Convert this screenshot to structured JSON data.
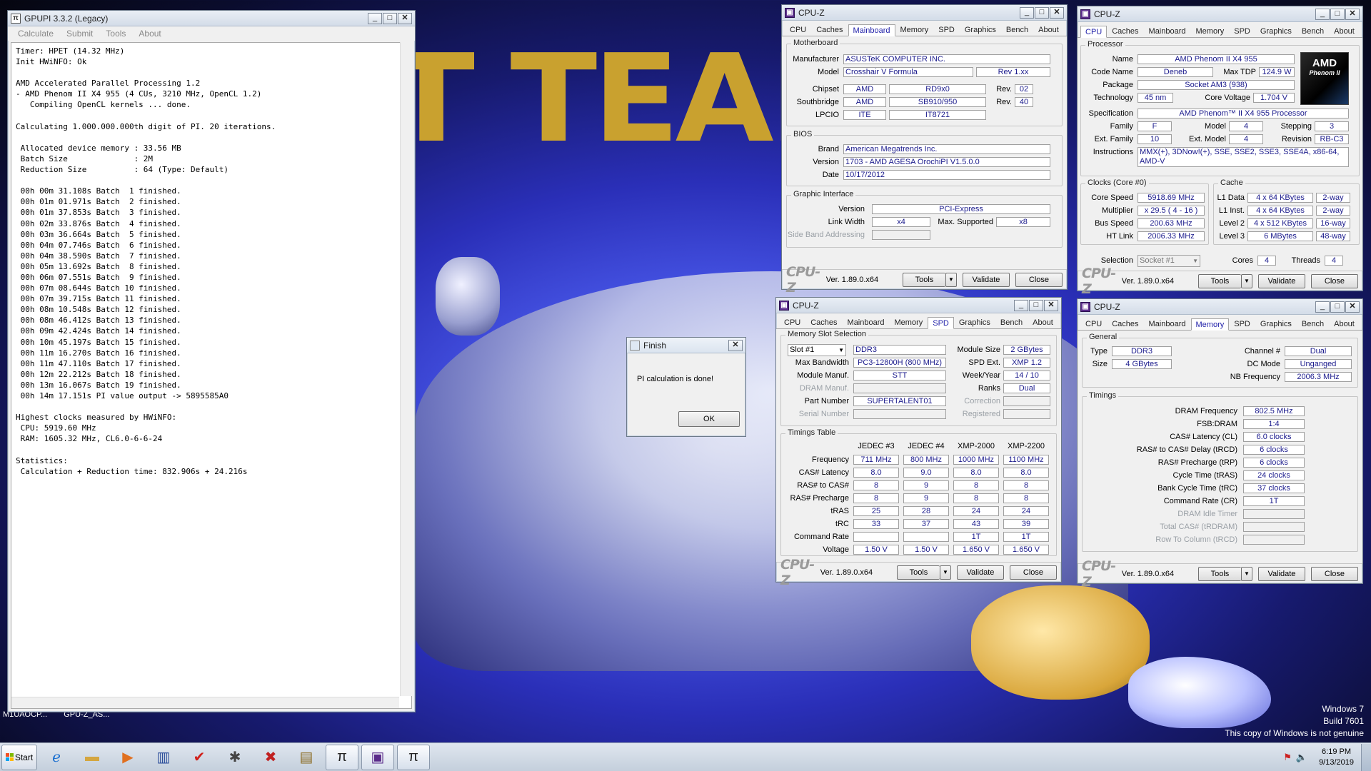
{
  "wallpaper_text": "T TEAM",
  "desktop": {
    "os_lines": [
      "Windows 7",
      "Build 7601",
      "This copy of Windows is not genuine"
    ],
    "shortcut_labels": [
      "M1UAOCP...",
      "GPU-Z_AS..."
    ]
  },
  "gpupi": {
    "title": "GPUPI 3.3.2 (Legacy)",
    "menu": [
      "Calculate",
      "Submit",
      "Tools",
      "About"
    ],
    "console": "Timer: HPET (14.32 MHz)\nInit HWiNFO: Ok\n\nAMD Accelerated Parallel Processing 1.2\n- AMD Phenom II X4 955 (4 CUs, 3210 MHz, OpenCL 1.2)\n   Compiling OpenCL kernels ... done.\n\nCalculating 1.000.000.000th digit of PI. 20 iterations.\n\n Allocated device memory : 33.56 MB\n Batch Size              : 2M\n Reduction Size          : 64 (Type: Default)\n\n 00h 00m 31.108s Batch  1 finished.\n 00h 01m 01.971s Batch  2 finished.\n 00h 01m 37.853s Batch  3 finished.\n 00h 02m 33.876s Batch  4 finished.\n 00h 03m 36.664s Batch  5 finished.\n 00h 04m 07.746s Batch  6 finished.\n 00h 04m 38.590s Batch  7 finished.\n 00h 05m 13.692s Batch  8 finished.\n 00h 06m 07.551s Batch  9 finished.\n 00h 07m 08.644s Batch 10 finished.\n 00h 07m 39.715s Batch 11 finished.\n 00h 08m 10.548s Batch 12 finished.\n 00h 08m 46.412s Batch 13 finished.\n 00h 09m 42.424s Batch 14 finished.\n 00h 10m 45.197s Batch 15 finished.\n 00h 11m 16.270s Batch 16 finished.\n 00h 11m 47.110s Batch 17 finished.\n 00h 12m 22.212s Batch 18 finished.\n 00h 13m 16.067s Batch 19 finished.\n 00h 14m 17.151s PI value output -> 5895585A0\n\nHighest clocks measured by HWiNFO:\n CPU: 5919.60 MHz\n RAM: 1605.32 MHz, CL6.0-6-6-24\n\nStatistics:\n Calculation + Reduction time: 832.906s + 24.216s"
  },
  "finish": {
    "title": "Finish",
    "message": "PI calculation is done!",
    "ok": "OK"
  },
  "cpuz_common": {
    "title": "CPU-Z",
    "tabs": [
      "CPU",
      "Caches",
      "Mainboard",
      "Memory",
      "SPD",
      "Graphics",
      "Bench",
      "About"
    ],
    "logo": "CPU-Z",
    "version": "Ver. 1.89.0.x64",
    "tools": "Tools",
    "validate": "Validate",
    "close": "Close"
  },
  "mainboard": {
    "grp_mb": "Motherboard",
    "manufacturer_lbl": "Manufacturer",
    "manufacturer": "ASUSTeK COMPUTER INC.",
    "model_lbl": "Model",
    "model": "Crosshair V Formula",
    "rev_model": "Rev 1.xx",
    "chipset_lbl": "Chipset",
    "chipset_v": "AMD",
    "chipset_m": "RD9x0",
    "rev_lbl": "Rev.",
    "chipset_rev": "02",
    "south_lbl": "Southbridge",
    "south_v": "AMD",
    "south_m": "SB910/950",
    "south_rev": "40",
    "lpcio_lbl": "LPCIO",
    "lpcio_v": "ITE",
    "lpcio_m": "IT8721",
    "grp_bios": "BIOS",
    "brand_lbl": "Brand",
    "brand": "American Megatrends Inc.",
    "version_lbl": "Version",
    "version": "1703 - AMD AGESA OrochiPI V1.5.0.0",
    "date_lbl": "Date",
    "date": "10/17/2012",
    "grp_gi": "Graphic Interface",
    "gi_ver_lbl": "Version",
    "gi_ver": "PCI-Express",
    "lw_lbl": "Link Width",
    "lw": "x4",
    "max_lbl": "Max. Supported",
    "max": "x8",
    "sba_lbl": "Side Band Addressing"
  },
  "cpu": {
    "grp_proc": "Processor",
    "name_lbl": "Name",
    "name": "AMD Phenom II X4 955",
    "code_lbl": "Code Name",
    "code": "Deneb",
    "tdp_lbl": "Max TDP",
    "tdp": "124.9 W",
    "pkg_lbl": "Package",
    "pkg": "Socket AM3 (938)",
    "tech_lbl": "Technology",
    "tech": "45 nm",
    "cv_lbl": "Core Voltage",
    "cv": "1.704 V",
    "spec_lbl": "Specification",
    "spec": "AMD Phenom™ II X4 955 Processor",
    "fam_lbl": "Family",
    "fam": "F",
    "model_lbl": "Model",
    "model": "4",
    "step_lbl": "Stepping",
    "step": "3",
    "efam_lbl": "Ext. Family",
    "efam": "10",
    "emod_lbl": "Ext. Model",
    "emod": "4",
    "rev_lbl": "Revision",
    "rev": "RB-C3",
    "instr_lbl": "Instructions",
    "instr1": "MMX(+), 3DNow!(+), SSE, SSE2, SSE3, SSE4A, x86-64,",
    "instr2": "AMD-V",
    "badge_line1": "AMD",
    "badge_line2": "Phenom II",
    "grp_clocks": "Clocks (Core #0)",
    "cs_lbl": "Core Speed",
    "cs": "5918.69 MHz",
    "mul_lbl": "Multiplier",
    "mul": "x 29.5 ( 4 - 16 )",
    "bus_lbl": "Bus Speed",
    "bus": "200.63 MHz",
    "ht_lbl": "HT Link",
    "ht": "2006.33 MHz",
    "grp_cache": "Cache",
    "l1d_lbl": "L1 Data",
    "l1d": "4 x 64 KBytes",
    "l1d_w": "2-way",
    "l1i_lbl": "L1 Inst.",
    "l1i": "4 x 64 KBytes",
    "l1i_w": "2-way",
    "l2_lbl": "Level 2",
    "l2": "4 x 512 KBytes",
    "l2_w": "16-way",
    "l3_lbl": "Level 3",
    "l3": "6 MBytes",
    "l3_w": "48-way",
    "sel_lbl": "Selection",
    "sel": "Socket #1",
    "cores_lbl": "Cores",
    "cores": "4",
    "threads_lbl": "Threads",
    "threads": "4"
  },
  "spd": {
    "grp_slot": "Memory Slot Selection",
    "slot": "Slot #1",
    "type": "DDR3",
    "msize_lbl": "Module Size",
    "msize": "2 GBytes",
    "bw_lbl": "Max Bandwidth",
    "bw": "PC3-12800H (800 MHz)",
    "ext_lbl": "SPD Ext.",
    "ext": "XMP 1.2",
    "mm_lbl": "Module Manuf.",
    "mm": "STT",
    "wy_lbl": "Week/Year",
    "wy": "14 / 10",
    "dm_lbl": "DRAM Manuf.",
    "ranks_lbl": "Ranks",
    "ranks": "Dual",
    "pn_lbl": "Part Number",
    "pn": "SUPERTALENT01",
    "corr_lbl": "Correction",
    "sn_lbl": "Serial Number",
    "reg_lbl": "Registered",
    "grp_tt": "Timings Table",
    "cols": [
      "JEDEC #3",
      "JEDEC #4",
      "XMP-2000",
      "XMP-2200"
    ],
    "rows": [
      {
        "label": "Frequency",
        "v": [
          "711 MHz",
          "800 MHz",
          "1000 MHz",
          "1100 MHz"
        ]
      },
      {
        "label": "CAS# Latency",
        "v": [
          "8.0",
          "9.0",
          "8.0",
          "8.0"
        ]
      },
      {
        "label": "RAS# to CAS#",
        "v": [
          "8",
          "9",
          "8",
          "8"
        ]
      },
      {
        "label": "RAS# Precharge",
        "v": [
          "8",
          "9",
          "8",
          "8"
        ]
      },
      {
        "label": "tRAS",
        "v": [
          "25",
          "28",
          "24",
          "24"
        ]
      },
      {
        "label": "tRC",
        "v": [
          "33",
          "37",
          "43",
          "39"
        ]
      },
      {
        "label": "Command Rate",
        "v": [
          "",
          "",
          "1T",
          "1T"
        ]
      },
      {
        "label": "Voltage",
        "v": [
          "1.50 V",
          "1.50 V",
          "1.650 V",
          "1.650 V"
        ]
      }
    ]
  },
  "memory": {
    "grp_gen": "General",
    "type_lbl": "Type",
    "type": "DDR3",
    "ch_lbl": "Channel #",
    "ch": "Dual",
    "size_lbl": "Size",
    "size": "4 GBytes",
    "dc_lbl": "DC Mode",
    "dc": "Unganged",
    "nb_lbl": "NB Frequency",
    "nb": "2006.3 MHz",
    "grp_tim": "Timings",
    "rows": [
      {
        "label": "DRAM Frequency",
        "v": "802.5 MHz",
        "dim": false
      },
      {
        "label": "FSB:DRAM",
        "v": "1:4",
        "dim": false
      },
      {
        "label": "CAS# Latency (CL)",
        "v": "6.0 clocks",
        "dim": false
      },
      {
        "label": "RAS# to CAS# Delay (tRCD)",
        "v": "6 clocks",
        "dim": false
      },
      {
        "label": "RAS# Precharge (tRP)",
        "v": "6 clocks",
        "dim": false
      },
      {
        "label": "Cycle Time (tRAS)",
        "v": "24 clocks",
        "dim": false
      },
      {
        "label": "Bank Cycle Time (tRC)",
        "v": "37 clocks",
        "dim": false
      },
      {
        "label": "Command Rate (CR)",
        "v": "1T",
        "dim": false
      },
      {
        "label": "DRAM Idle Timer",
        "v": "",
        "dim": true
      },
      {
        "label": "Total CAS# (tRDRAM)",
        "v": "",
        "dim": true
      },
      {
        "label": "Row To Column (tRCD)",
        "v": "",
        "dim": true
      }
    ]
  },
  "taskbar": {
    "start": "Start",
    "time": "6:19 PM",
    "date": "9/13/2019"
  }
}
